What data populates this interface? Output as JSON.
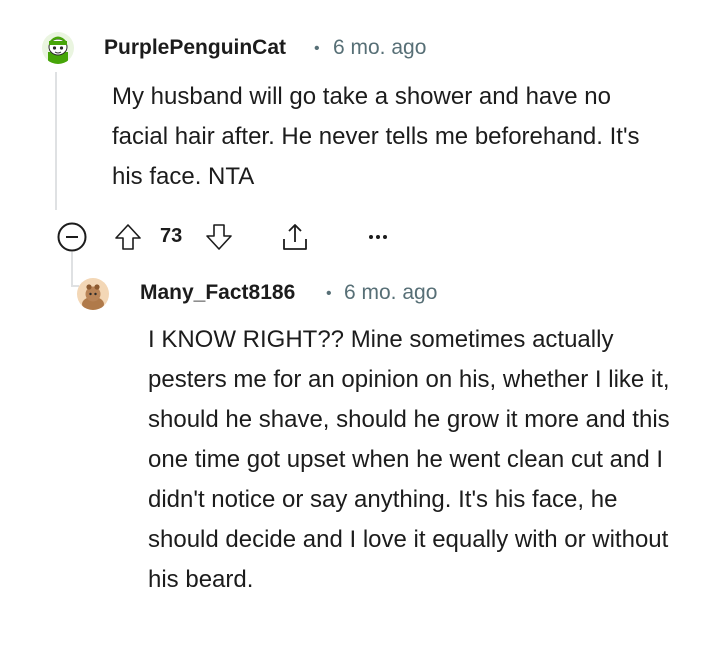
{
  "comment1": {
    "username": "PurplePenguinCat",
    "separator": "•",
    "time": "6 mo. ago",
    "body": "My husband will go take a shower and have no facial hair after. He never tells me beforehand. It's his face. NTA",
    "votes": "73",
    "avatar_icon": "snoo-avatar-icon",
    "collapse_icon": "minus-circle-icon",
    "upvote_icon": "upvote-arrow-icon",
    "downvote_icon": "downvote-arrow-icon",
    "share_icon": "share-icon",
    "more_icon": "more-options-icon"
  },
  "comment2": {
    "username": "Many_Fact8186",
    "separator": "•",
    "time": "6 mo. ago",
    "body": "I KNOW RIGHT?? Mine sometimes actually pesters me for an opinion on his, whether I like it, should he shave, should he grow it more and this one time got upset when he went clean cut and I didn't notice or say anything. It's his face, he should decide and I love it equally with or without his beard.",
    "avatar_icon": "snoo-avatar-icon"
  },
  "colors": {
    "thread_line": "#dfe1e3",
    "meta_gray": "#576f76",
    "text": "#1c1c1c",
    "avatar1_green": "#46a508",
    "avatar2_bg": "#f3d7b6"
  }
}
